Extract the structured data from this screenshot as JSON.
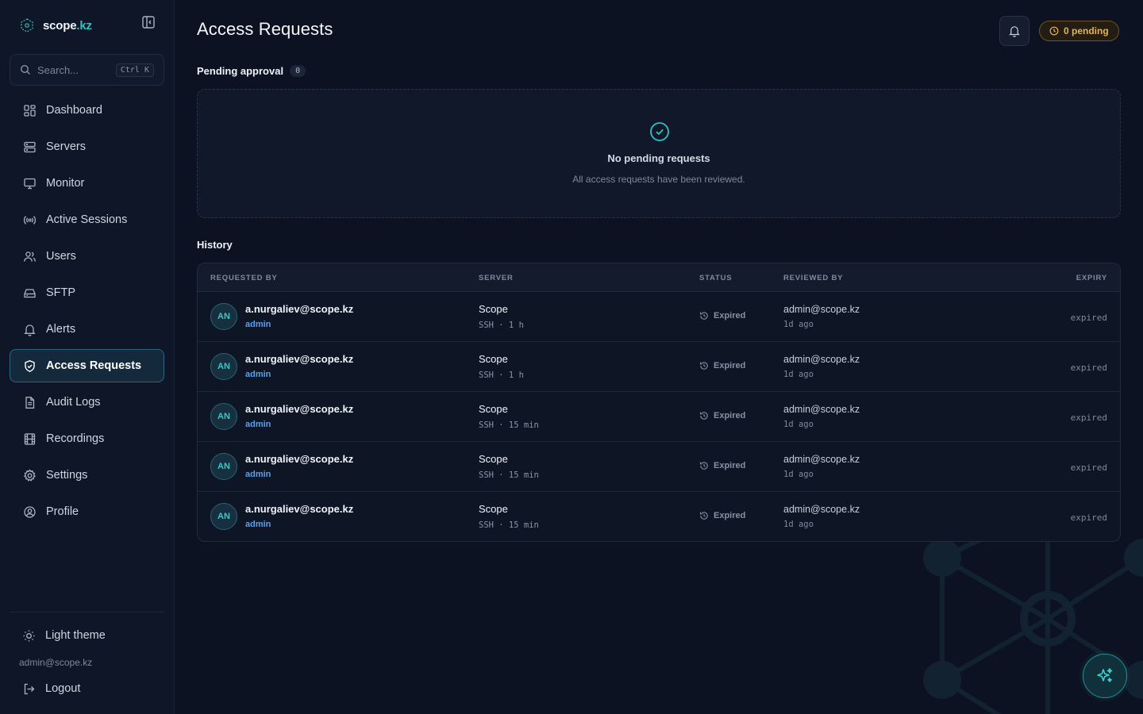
{
  "brand": {
    "name_part1": "scope",
    "name_part2": ".kz"
  },
  "search": {
    "placeholder": "Search...",
    "shortcut": "Ctrl K"
  },
  "sidebar": {
    "items": [
      {
        "label": "Dashboard",
        "icon": "dashboard-icon"
      },
      {
        "label": "Servers",
        "icon": "servers-icon"
      },
      {
        "label": "Monitor",
        "icon": "monitor-icon"
      },
      {
        "label": "Active Sessions",
        "icon": "broadcast-icon"
      },
      {
        "label": "Users",
        "icon": "users-icon"
      },
      {
        "label": "SFTP",
        "icon": "drive-icon"
      },
      {
        "label": "Alerts",
        "icon": "bell-icon"
      },
      {
        "label": "Access Requests",
        "icon": "shield-check-icon",
        "active": true
      },
      {
        "label": "Audit Logs",
        "icon": "document-icon"
      },
      {
        "label": "Recordings",
        "icon": "film-icon"
      },
      {
        "label": "Settings",
        "icon": "gear-icon"
      },
      {
        "label": "Profile",
        "icon": "user-circle-icon"
      }
    ],
    "theme_toggle": "Light theme",
    "user_email": "admin@scope.kz",
    "logout": "Logout"
  },
  "header": {
    "title": "Access Requests",
    "pending_badge": "0 pending"
  },
  "pending": {
    "label": "Pending approval",
    "count": "0",
    "empty_title": "No pending requests",
    "empty_subtitle": "All access requests have been reviewed."
  },
  "history": {
    "label": "History",
    "columns": [
      "REQUESTED BY",
      "SERVER",
      "STATUS",
      "REVIEWED BY",
      "EXPIRY"
    ],
    "rows": [
      {
        "initials": "AN",
        "email": "a.nurgaliev@scope.kz",
        "role": "admin",
        "server": "Scope",
        "meta": "SSH · 1 h",
        "status": "Expired",
        "reviewer": "admin@scope.kz",
        "reviewed_ago": "1d ago",
        "expiry": "expired"
      },
      {
        "initials": "AN",
        "email": "a.nurgaliev@scope.kz",
        "role": "admin",
        "server": "Scope",
        "meta": "SSH · 1 h",
        "status": "Expired",
        "reviewer": "admin@scope.kz",
        "reviewed_ago": "1d ago",
        "expiry": "expired"
      },
      {
        "initials": "AN",
        "email": "a.nurgaliev@scope.kz",
        "role": "admin",
        "server": "Scope",
        "meta": "SSH · 15 min",
        "status": "Expired",
        "reviewer": "admin@scope.kz",
        "reviewed_ago": "1d ago",
        "expiry": "expired"
      },
      {
        "initials": "AN",
        "email": "a.nurgaliev@scope.kz",
        "role": "admin",
        "server": "Scope",
        "meta": "SSH · 15 min",
        "status": "Expired",
        "reviewer": "admin@scope.kz",
        "reviewed_ago": "1d ago",
        "expiry": "expired"
      },
      {
        "initials": "AN",
        "email": "a.nurgaliev@scope.kz",
        "role": "admin",
        "server": "Scope",
        "meta": "SSH · 15 min",
        "status": "Expired",
        "reviewer": "admin@scope.kz",
        "reviewed_ago": "1d ago",
        "expiry": "expired"
      }
    ]
  },
  "colors": {
    "accent": "#2ec4c4",
    "pending": "#e7b34e",
    "role": "#5aa0e8",
    "background": "#0c1221"
  }
}
